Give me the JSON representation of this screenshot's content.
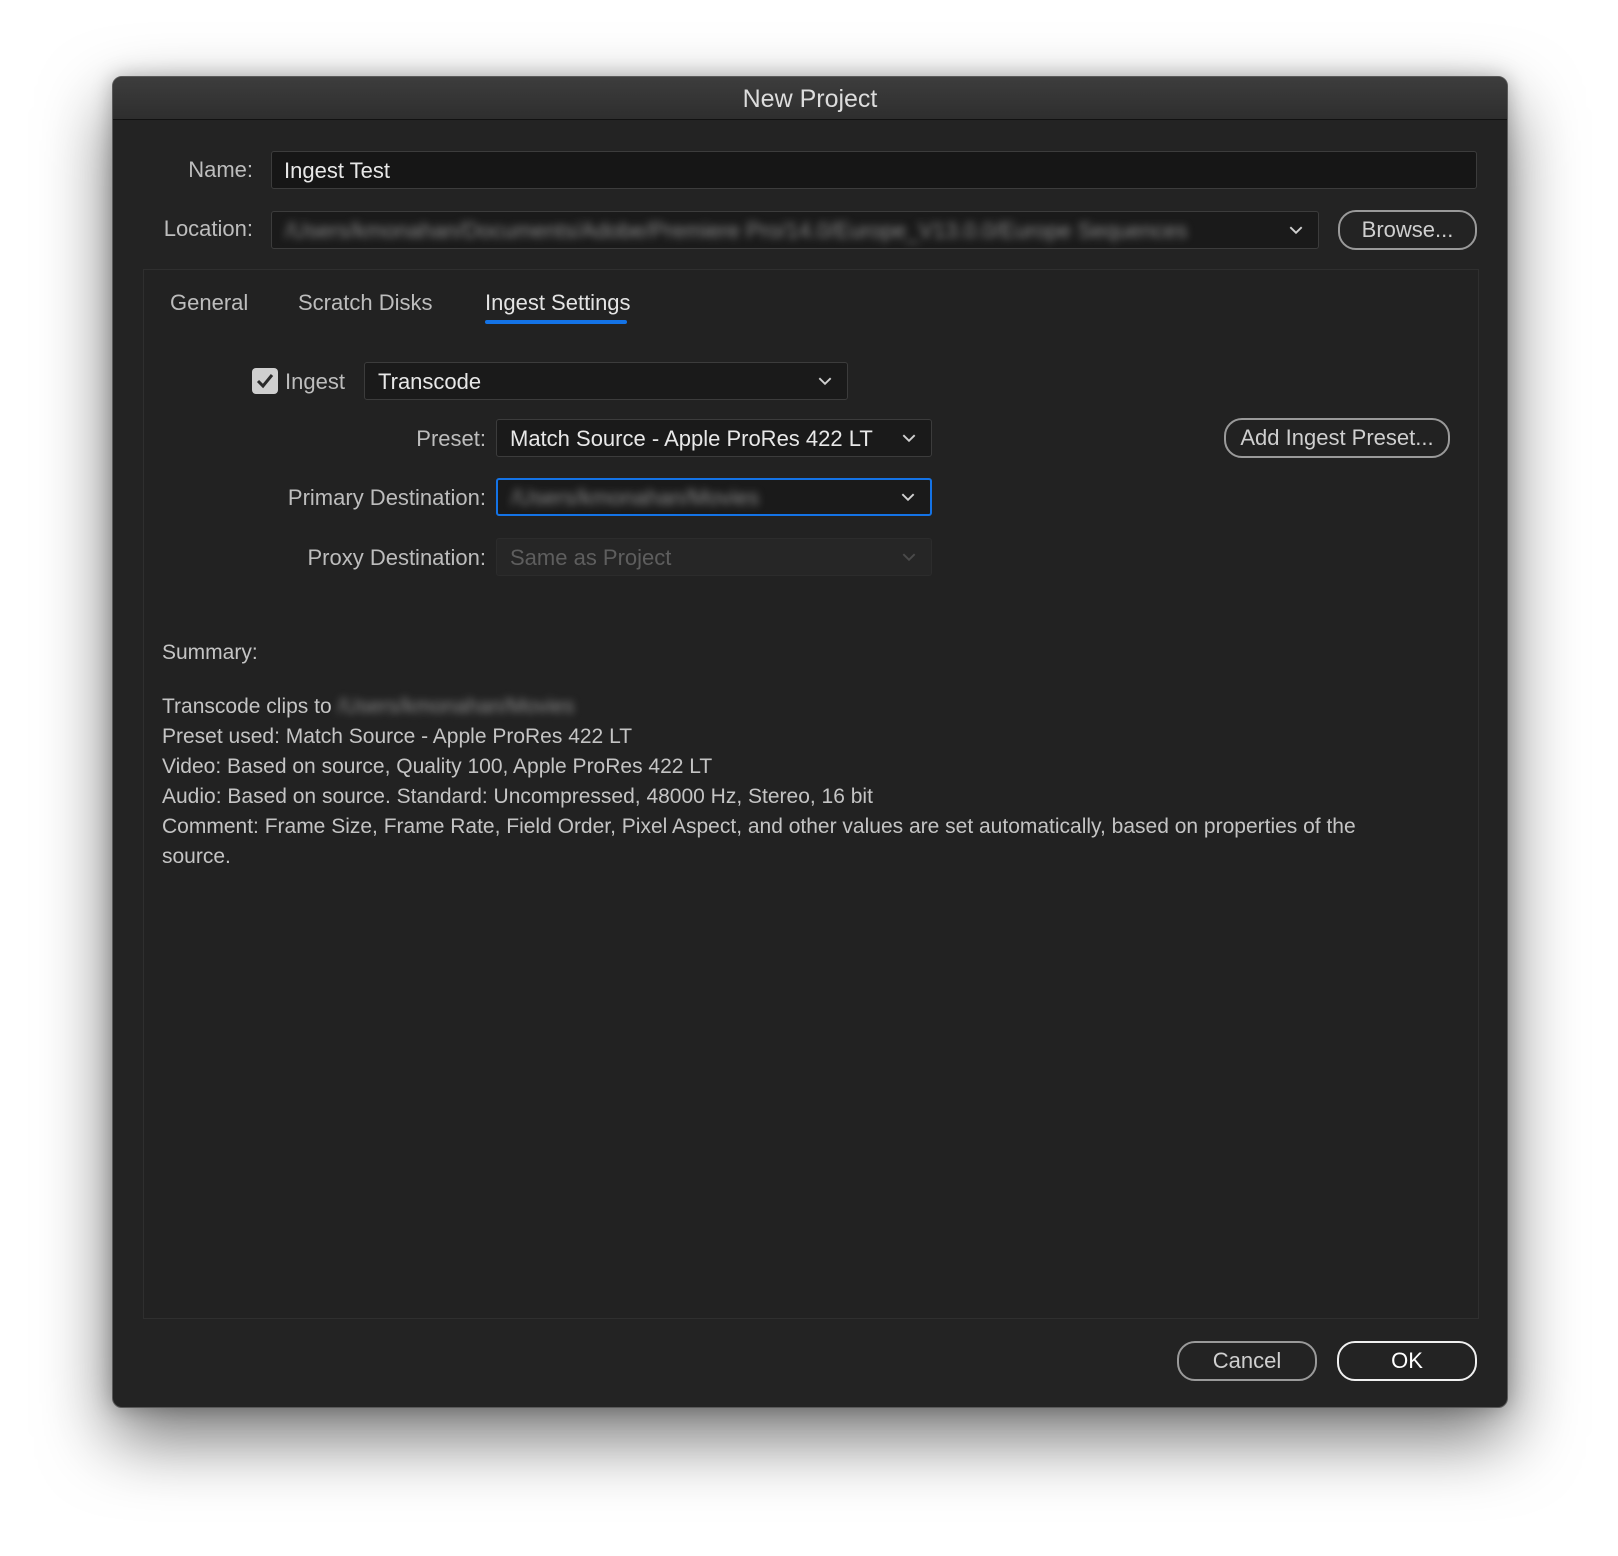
{
  "window": {
    "title": "New Project"
  },
  "name": {
    "label": "Name:",
    "value": "Ingest Test"
  },
  "location": {
    "label": "Location:",
    "value": "/Users/kmonahan/Documents/Adobe/Premiere Pro/14.0/Europe_V13.0.0/Europe Sequences",
    "browse_label": "Browse..."
  },
  "tabs": [
    {
      "label": "General"
    },
    {
      "label": "Scratch Disks"
    },
    {
      "label": "Ingest Settings"
    }
  ],
  "ingest": {
    "checkbox_label": "Ingest",
    "checked": true,
    "mode": "Transcode",
    "preset_label": "Preset:",
    "preset_value": "Match Source - Apple ProRes 422 LT",
    "add_preset_label": "Add Ingest Preset...",
    "primary_label": "Primary Destination:",
    "primary_value": "/Users/kmonahan/Movies",
    "proxy_label": "Proxy Destination:",
    "proxy_value": "Same as Project"
  },
  "summary": {
    "heading": "Summary:",
    "line1_prefix": "Transcode clips to",
    "line1_path": "/Users/kmonahan/Movies",
    "line2": "Preset used: Match Source - Apple ProRes 422 LT",
    "line3": "Video: Based on source, Quality 100, Apple ProRes 422 LT",
    "line4": "Audio: Based on source. Standard: Uncompressed, 48000 Hz, Stereo, 16 bit",
    "line5": "Comment: Frame Size, Frame Rate, Field Order, Pixel Aspect, and other values are set automatically, based on properties of the",
    "line6": "source."
  },
  "footer": {
    "cancel_label": "Cancel",
    "ok_label": "OK"
  },
  "colors": {
    "accent": "#1473e6",
    "background": "#232323",
    "field": "#161616"
  }
}
